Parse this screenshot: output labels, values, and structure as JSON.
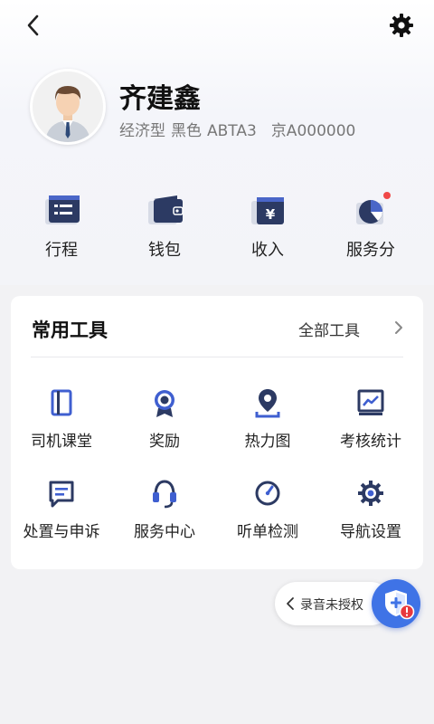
{
  "profile": {
    "name": "齐建鑫",
    "car_type": "经济型",
    "car_color": "黑色",
    "car_model": "ABTA3",
    "plate": "京A000000"
  },
  "quick_actions": [
    {
      "label": "行程",
      "icon": "itinerary-list-icon"
    },
    {
      "label": "钱包",
      "icon": "wallet-icon"
    },
    {
      "label": "收入",
      "icon": "income-yuan-icon"
    },
    {
      "label": "服务分",
      "icon": "service-score-pie-icon"
    }
  ],
  "tools": {
    "title": "常用工具",
    "all_label": "全部工具",
    "items": [
      {
        "label": "司机课堂",
        "icon": "book-icon"
      },
      {
        "label": "奖励",
        "icon": "award-medal-icon"
      },
      {
        "label": "热力图",
        "icon": "location-pin-icon"
      },
      {
        "label": "考核统计",
        "icon": "chart-board-icon"
      },
      {
        "label": "处置与申诉",
        "icon": "message-icon"
      },
      {
        "label": "服务中心",
        "icon": "headset-icon"
      },
      {
        "label": "听单检测",
        "icon": "gauge-icon"
      },
      {
        "label": "导航设置",
        "icon": "gear-icon"
      }
    ]
  },
  "recording": {
    "label": "录音未授权"
  },
  "colors": {
    "accent": "#3f73e6",
    "icon_dark": "#2c3a63",
    "badge_red": "#f04848"
  }
}
